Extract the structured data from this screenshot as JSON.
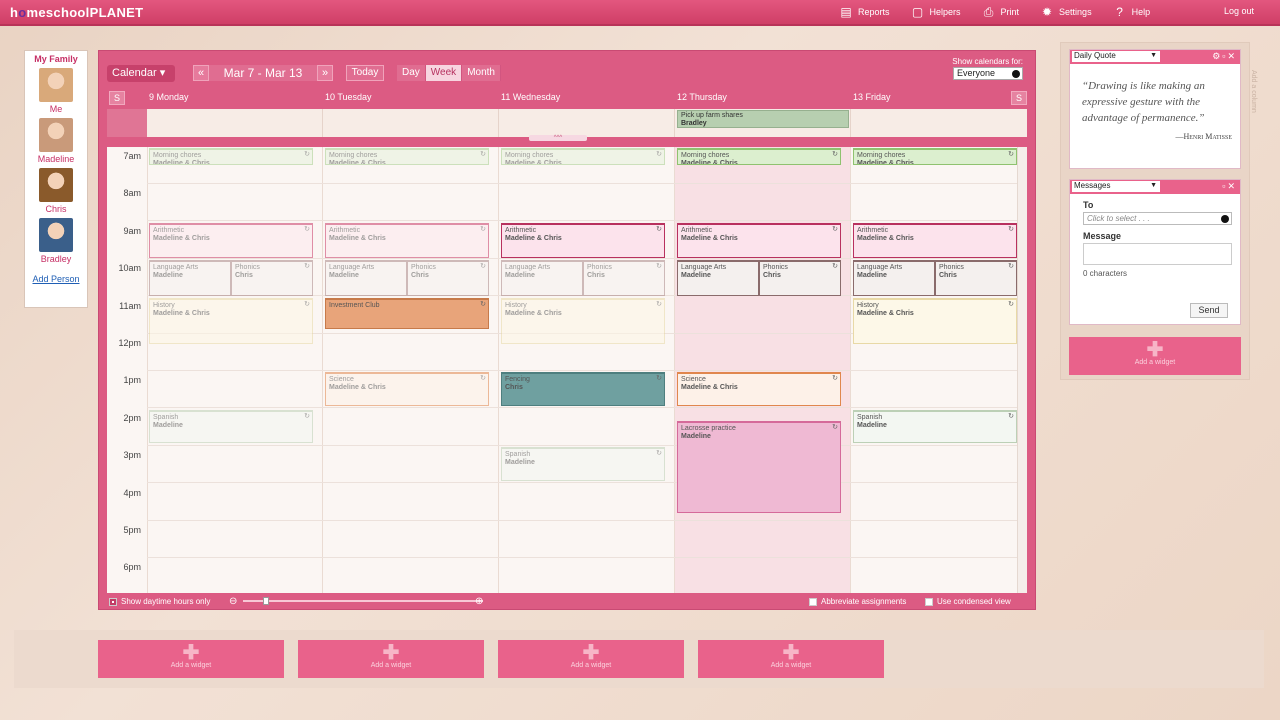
{
  "brand": {
    "prefix": "h",
    "o": "o",
    "rest": "meschool",
    "planet": "PLANET"
  },
  "topnav": [
    {
      "label": "Reports",
      "icon": "reports-icon"
    },
    {
      "label": "Helpers",
      "icon": "helpers-icon"
    },
    {
      "label": "Print",
      "icon": "print-icon"
    },
    {
      "label": "Settings",
      "icon": "settings-icon"
    },
    {
      "label": "Help",
      "icon": "help-icon"
    }
  ],
  "logout": "Log out",
  "family": {
    "title": "My Family",
    "people": [
      {
        "name": "Me",
        "color": "#d9a97a"
      },
      {
        "name": "Madeline",
        "color": "#c99a7a"
      },
      {
        "name": "Chris",
        "color": "#8a5a2b"
      },
      {
        "name": "Bradley",
        "color": "#3a5f8a"
      }
    ],
    "add_person": "Add Person"
  },
  "calendar": {
    "menu_label": "Calendar ▾",
    "prev": "«",
    "next": "»",
    "range": "Mar 7 - Mar 13",
    "today": "Today",
    "views": [
      {
        "label": "Day",
        "active": false
      },
      {
        "label": "Week",
        "active": true
      },
      {
        "label": "Month",
        "active": false
      }
    ],
    "show_for_label": "Show calendars for:",
    "show_for_value": "Everyone",
    "weekend_btn": "S",
    "days": [
      "9 Monday",
      "10 Tuesday",
      "11 Wednesday",
      "12 Thursday",
      "13 Friday"
    ],
    "allday_event": {
      "title": "Pick up farm shares",
      "who": "Bradley"
    },
    "grab_label": "^^^",
    "hours": [
      "7am",
      "8am",
      "9am",
      "10am",
      "11am",
      "12pm",
      "1pm",
      "2pm",
      "3pm",
      "4pm",
      "5pm",
      "6pm"
    ],
    "events": [
      {
        "day": 0,
        "start": 7.0,
        "end": 7.5,
        "title": "Morning chores",
        "who": "Madeline & Chris",
        "bg": "#e6f2dc",
        "border": "#a7cf8e",
        "faded": true
      },
      {
        "day": 1,
        "start": 7.0,
        "end": 7.5,
        "title": "Morning chores",
        "who": "Madeline & Chris",
        "bg": "#e6f2dc",
        "border": "#a7cf8e",
        "faded": true
      },
      {
        "day": 2,
        "start": 7.0,
        "end": 7.5,
        "title": "Morning chores",
        "who": "Madeline & Chris",
        "bg": "#e6f2dc",
        "border": "#a7cf8e",
        "faded": true
      },
      {
        "day": 3,
        "start": 7.0,
        "end": 7.5,
        "title": "Morning chores",
        "who": "Madeline & Chris",
        "bg": "#dcefcf",
        "border": "#8fc26f",
        "faded": false
      },
      {
        "day": 4,
        "start": 7.0,
        "end": 7.5,
        "title": "Morning chores",
        "who": "Madeline & Chris",
        "bg": "#dcefcf",
        "border": "#8fc26f",
        "faded": false
      },
      {
        "day": 0,
        "start": 9.0,
        "end": 10.0,
        "title": "Arithmetic",
        "who": "Madeline & Chris",
        "bg": "#fde8ef",
        "border": "#c93a68",
        "faded": true
      },
      {
        "day": 1,
        "start": 9.0,
        "end": 10.0,
        "title": "Arithmetic",
        "who": "Madeline & Chris",
        "bg": "#fde8ef",
        "border": "#c93a68",
        "faded": true
      },
      {
        "day": 2,
        "start": 9.0,
        "end": 10.0,
        "title": "Arithmetic",
        "who": "Madeline & Chris",
        "bg": "#fce3ec",
        "border": "#b8315e",
        "faded": false
      },
      {
        "day": 3,
        "start": 9.0,
        "end": 10.0,
        "title": "Arithmetic",
        "who": "Madeline & Chris",
        "bg": "#fce3ec",
        "border": "#b8315e",
        "faded": false
      },
      {
        "day": 4,
        "start": 9.0,
        "end": 10.0,
        "title": "Arithmetic",
        "who": "Madeline & Chris",
        "bg": "#fce3ec",
        "border": "#b8315e",
        "faded": false
      },
      {
        "day": 0,
        "start": 10.0,
        "end": 11.0,
        "half": 0,
        "title": "Language Arts",
        "who": "Madeline",
        "bg": "#f6f2f0",
        "border": "#a88",
        "faded": true
      },
      {
        "day": 0,
        "start": 10.0,
        "end": 11.0,
        "half": 1,
        "title": "Phonics",
        "who": "Chris",
        "bg": "#f6f2f0",
        "border": "#a88",
        "faded": true
      },
      {
        "day": 1,
        "start": 10.0,
        "end": 11.0,
        "half": 0,
        "title": "Language Arts",
        "who": "Madeline",
        "bg": "#f6f2f0",
        "border": "#a88",
        "faded": true
      },
      {
        "day": 1,
        "start": 10.0,
        "end": 11.0,
        "half": 1,
        "title": "Phonics",
        "who": "Chris",
        "bg": "#f6f2f0",
        "border": "#a88",
        "faded": true
      },
      {
        "day": 2,
        "start": 10.0,
        "end": 11.0,
        "half": 0,
        "title": "Language Arts",
        "who": "Madeline",
        "bg": "#f6f2f0",
        "border": "#a88",
        "faded": true
      },
      {
        "day": 2,
        "start": 10.0,
        "end": 11.0,
        "half": 1,
        "title": "Phonics",
        "who": "Chris",
        "bg": "#f6f2f0",
        "border": "#a88",
        "faded": true
      },
      {
        "day": 3,
        "start": 10.0,
        "end": 11.0,
        "half": 0,
        "title": "Language Arts",
        "who": "Madeline",
        "bg": "#f4f0ee",
        "border": "#8a6b6b",
        "faded": false
      },
      {
        "day": 3,
        "start": 10.0,
        "end": 11.0,
        "half": 1,
        "title": "Phonics",
        "who": "Chris",
        "bg": "#f4f0ee",
        "border": "#8a6b6b",
        "faded": false
      },
      {
        "day": 4,
        "start": 10.0,
        "end": 11.0,
        "half": 0,
        "title": "Language Arts",
        "who": "Madeline",
        "bg": "#f4f0ee",
        "border": "#8a6b6b",
        "faded": false
      },
      {
        "day": 4,
        "start": 10.0,
        "end": 11.0,
        "half": 1,
        "title": "Phonics",
        "who": "Chris",
        "bg": "#f4f0ee",
        "border": "#8a6b6b",
        "faded": false
      },
      {
        "day": 0,
        "start": 11.0,
        "end": 12.3,
        "title": "History",
        "who": "Madeline & Chris",
        "bg": "#fdf7e6",
        "border": "#e8d9a6",
        "faded": true
      },
      {
        "day": 1,
        "start": 11.0,
        "end": 11.9,
        "title": "Investment Club",
        "who": "",
        "bg": "#e8a47a",
        "border": "#c77a4a",
        "faded": false
      },
      {
        "day": 2,
        "start": 11.0,
        "end": 12.3,
        "title": "History",
        "who": "Madeline & Chris",
        "bg": "#fdf7e6",
        "border": "#e8d9a6",
        "faded": true
      },
      {
        "day": 4,
        "start": 11.0,
        "end": 12.3,
        "title": "History",
        "who": "Madeline & Chris",
        "bg": "#fdf8e8",
        "border": "#e8d9a6",
        "faded": false
      },
      {
        "day": 1,
        "start": 13.0,
        "end": 13.95,
        "title": "Science",
        "who": "Madeline & Chris",
        "bg": "#fdf1e8",
        "border": "#e0874d",
        "faded": true
      },
      {
        "day": 2,
        "start": 13.0,
        "end": 13.95,
        "title": "Fencing",
        "who": "Chris",
        "bg": "#6fa0a0",
        "border": "#4e7f7f",
        "faded": false
      },
      {
        "day": 3,
        "start": 13.0,
        "end": 13.95,
        "title": "Science",
        "who": "Madeline & Chris",
        "bg": "#fdf1e8",
        "border": "#e0874d",
        "faded": false
      },
      {
        "day": 0,
        "start": 14.0,
        "end": 14.95,
        "title": "Spanish",
        "who": "Madeline",
        "bg": "#f3f7f2",
        "border": "#bcd0b6",
        "faded": true
      },
      {
        "day": 4,
        "start": 14.0,
        "end": 14.95,
        "title": "Spanish",
        "who": "Madeline",
        "bg": "#f3f7f2",
        "border": "#bcd0b6",
        "faded": false
      },
      {
        "day": 2,
        "start": 15.0,
        "end": 15.95,
        "title": "Spanish",
        "who": "Madeline",
        "bg": "#f3f7f2",
        "border": "#bcd0b6",
        "faded": true
      },
      {
        "day": 3,
        "start": 14.3,
        "end": 16.8,
        "title": "Lacrosse practice",
        "who": "Madeline",
        "bg": "#efb9d3",
        "border": "#d56a9a",
        "faded": false
      }
    ],
    "footer": {
      "daytime_only": "Show daytime hours only",
      "abbreviate": "Abbreviate assignments",
      "condensed": "Use condensed view"
    }
  },
  "widgets": {
    "quote": {
      "select": "Daily Quote",
      "text": "“Drawing is like making an expressive gesture with the advantage of permanence.”",
      "author": "—Henri Matisse"
    },
    "messages": {
      "select": "Messages",
      "to_label": "To",
      "to_placeholder": "Click to select . . .",
      "message_label": "Message",
      "count": "0 characters",
      "send": "Send"
    },
    "add_widget": "Add a widget",
    "side_tab": "Add a column"
  }
}
